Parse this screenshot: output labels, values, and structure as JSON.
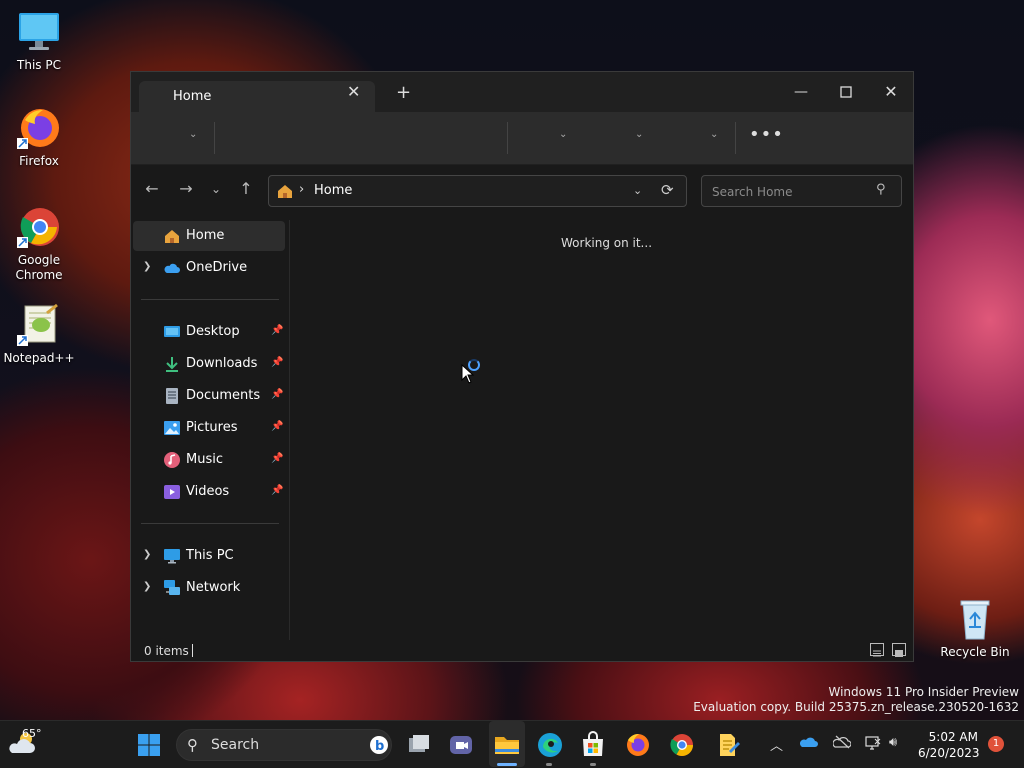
{
  "desktop": {
    "icons": [
      {
        "label": "This PC"
      },
      {
        "label": "Firefox"
      },
      {
        "label": "Google Chrome"
      },
      {
        "label": "Notepad++"
      },
      {
        "label": "Recycle Bin"
      }
    ]
  },
  "explorer": {
    "tab_label": "Home",
    "address": {
      "path": "Home"
    },
    "search": {
      "placeholder": "Search Home"
    },
    "sidebar": {
      "items": [
        {
          "label": "Home"
        },
        {
          "label": "OneDrive"
        },
        {
          "label": "Desktop"
        },
        {
          "label": "Downloads"
        },
        {
          "label": "Documents"
        },
        {
          "label": "Pictures"
        },
        {
          "label": "Music"
        },
        {
          "label": "Videos"
        },
        {
          "label": "This PC"
        },
        {
          "label": "Network"
        }
      ]
    },
    "content": {
      "status_message": "Working on it..."
    },
    "statusbar": {
      "item_count": "0 items"
    }
  },
  "watermark": {
    "line1": "Windows 11 Pro Insider Preview",
    "line2": "Evaluation copy. Build 25375.zn_release.230520-1632"
  },
  "taskbar": {
    "weather_temp": "65°",
    "search_label": "Search",
    "time": "5:02 AM",
    "date": "6/20/2023",
    "notification_count": "1"
  },
  "colors": {
    "accent": "#4ea1ff",
    "window_bg": "#191919",
    "commandbar_bg": "#2c2c2c",
    "taskbar_bg": "#1c1c1c"
  }
}
